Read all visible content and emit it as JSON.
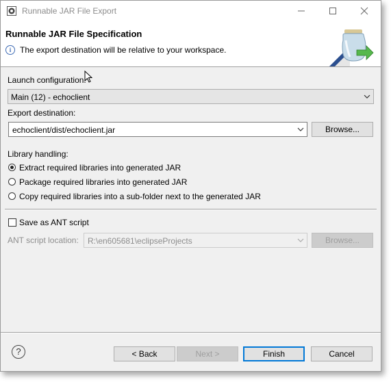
{
  "window": {
    "title": "Runnable JAR File Export",
    "controls": [
      "minimize",
      "maximize",
      "close"
    ]
  },
  "header": {
    "title": "Runnable JAR File Specification",
    "message": "The export destination will be relative to your workspace."
  },
  "launch": {
    "label": "Launch configuration:",
    "value": "Main (12) - echoclient"
  },
  "export": {
    "label": "Export destination:",
    "value": "echoclient/dist/echoclient.jar",
    "browse_label": "Browse..."
  },
  "library": {
    "label": "Library handling:",
    "options": [
      {
        "label": "Extract required libraries into generated JAR",
        "selected": true
      },
      {
        "label": "Package required libraries into generated JAR",
        "selected": false
      },
      {
        "label": "Copy required libraries into a sub-folder next to the generated JAR",
        "selected": false
      }
    ]
  },
  "ant": {
    "save_label": "Save as ANT script",
    "save_checked": false,
    "location_label": "ANT script location:",
    "location_value": "R:\\en605681\\eclipseProjects",
    "browse_label": "Browse..."
  },
  "footer": {
    "back_label": "< Back",
    "next_label": "Next >",
    "finish_label": "Finish",
    "cancel_label": "Cancel"
  },
  "colors": {
    "accent": "#0078d7",
    "info": "#3c6ab4"
  }
}
